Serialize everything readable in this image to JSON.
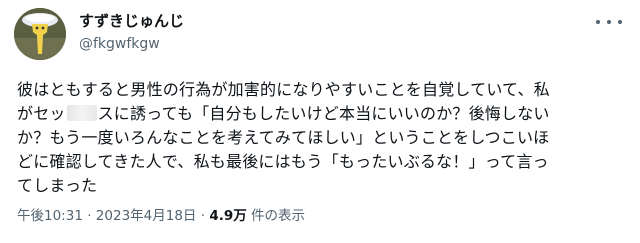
{
  "user": {
    "display_name": "すずきじゅんじ",
    "handle": "@fkgwfkgw"
  },
  "tweet": {
    "line1": "彼はともすると男性の行為が加害的になりやすいことを自覚していて、私",
    "line2_before": "がセッ",
    "line2_after": "スに誘っても「自分もしたいけど本当にいいのか？後悔しない",
    "line3": "か？もう一度いろんなことを考えてみてほしい」ということをしつこいほ",
    "line4": "どに確認してきた人で、私も最後にはもう「もったいぶるな！」って言っ",
    "line5": "てしまった"
  },
  "meta": {
    "time": "午後10:31",
    "separator1": "·",
    "date": "2023年4月18日",
    "separator2": "·",
    "views_count": "4.9万",
    "views_label": "件の表示"
  },
  "icons": {
    "more": "more-horizontal-icon",
    "avatar": "avatar-illustration"
  },
  "colors": {
    "text_primary": "#0f1419",
    "text_secondary": "#536471",
    "avatar_bg": "#5e6145"
  }
}
